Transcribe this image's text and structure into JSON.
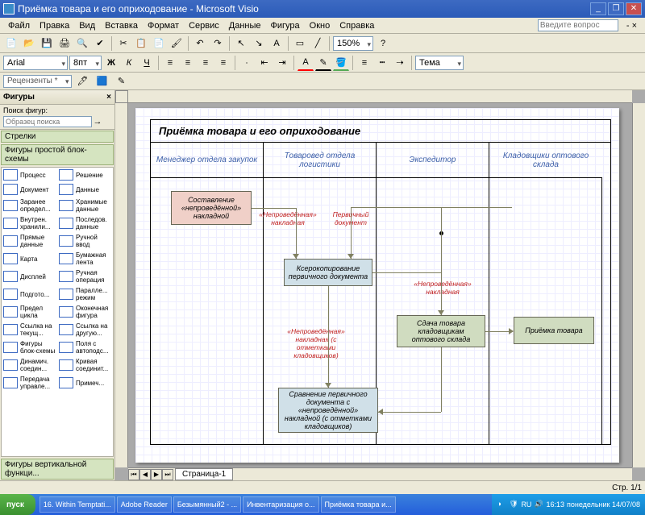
{
  "titlebar": {
    "title": "Приёмка товара и его оприходование - Microsoft Visio"
  },
  "menu": {
    "file": "Файл",
    "edit": "Правка",
    "view": "Вид",
    "insert": "Вставка",
    "format": "Формат",
    "tools": "Сервис",
    "data": "Данные",
    "shape": "Фигура",
    "window": "Окно",
    "help": "Справка",
    "question": "Введите вопрос"
  },
  "format": {
    "font": "Arial",
    "size": "8пт",
    "zoom": "150%",
    "theme": "Тема"
  },
  "rev": {
    "label": "Рецензенты *"
  },
  "sidebar": {
    "title": "Фигуры",
    "search_label": "Поиск фигур:",
    "search_ph": "Образец поиска",
    "cat1": "Стрелки",
    "cat2": "Фигуры простой блок-схемы",
    "cat3": "Фигуры вертикальной функци...",
    "shapes": [
      {
        "l": "Процесс"
      },
      {
        "l": "Решение"
      },
      {
        "l": "Документ"
      },
      {
        "l": "Данные"
      },
      {
        "l": "Заранее определ..."
      },
      {
        "l": "Хранимые данные"
      },
      {
        "l": "Внутрен. хранили..."
      },
      {
        "l": "Последов. данные"
      },
      {
        "l": "Прямые данные"
      },
      {
        "l": "Ручной ввод"
      },
      {
        "l": "Карта"
      },
      {
        "l": "Бумажная лента"
      },
      {
        "l": "Дисплей"
      },
      {
        "l": "Ручная операция"
      },
      {
        "l": "Подгото..."
      },
      {
        "l": "Паралле... режим"
      },
      {
        "l": "Предел цикла"
      },
      {
        "l": "Оконечная фигура"
      },
      {
        "l": "Ссылка на текущ..."
      },
      {
        "l": "Ссылка на другую..."
      },
      {
        "l": "Фигуры блок-схемы"
      },
      {
        "l": "Поля с автоподс..."
      },
      {
        "l": "Динамич. соедин..."
      },
      {
        "l": "Кривая соединит..."
      },
      {
        "l": "Передача управле..."
      },
      {
        "l": "Примеч..."
      }
    ]
  },
  "diagram": {
    "title": "Приёмка товара и его оприходование",
    "lanes": [
      "Менеджер отдела закупок",
      "Товаровед отдела логистики",
      "Экспедитор",
      "Кладовщики оптового склада"
    ],
    "b1": "Составление «непроведённой» накладной",
    "l1": "«Непроведённая» накладная",
    "l2": "Первичный документ",
    "b2": "Ксерокопирование первичного документа",
    "l3": "«Непроведённая» накладная",
    "b3": "Сдача товара кладовщикам оптового склада",
    "b4": "Приёмка товара",
    "l4": "«Непроведённая» накладная (с отметками кладовщиков)",
    "b5": "Сравнение первичного документа с «непроведённой» накладной (с отметками кладовщиков)"
  },
  "page": {
    "tab": "Страница-1",
    "indicator": "Стр. 1/1"
  },
  "taskbar": {
    "start": "пуск",
    "items": [
      "16. Within Temptati...",
      "Adobe Reader",
      "Безымянный2 - ...",
      "Инвентаризация о...",
      "Приёмка товара и..."
    ],
    "lang": "RU",
    "time": "16:13",
    "date": "понедельник 14/07/08"
  }
}
